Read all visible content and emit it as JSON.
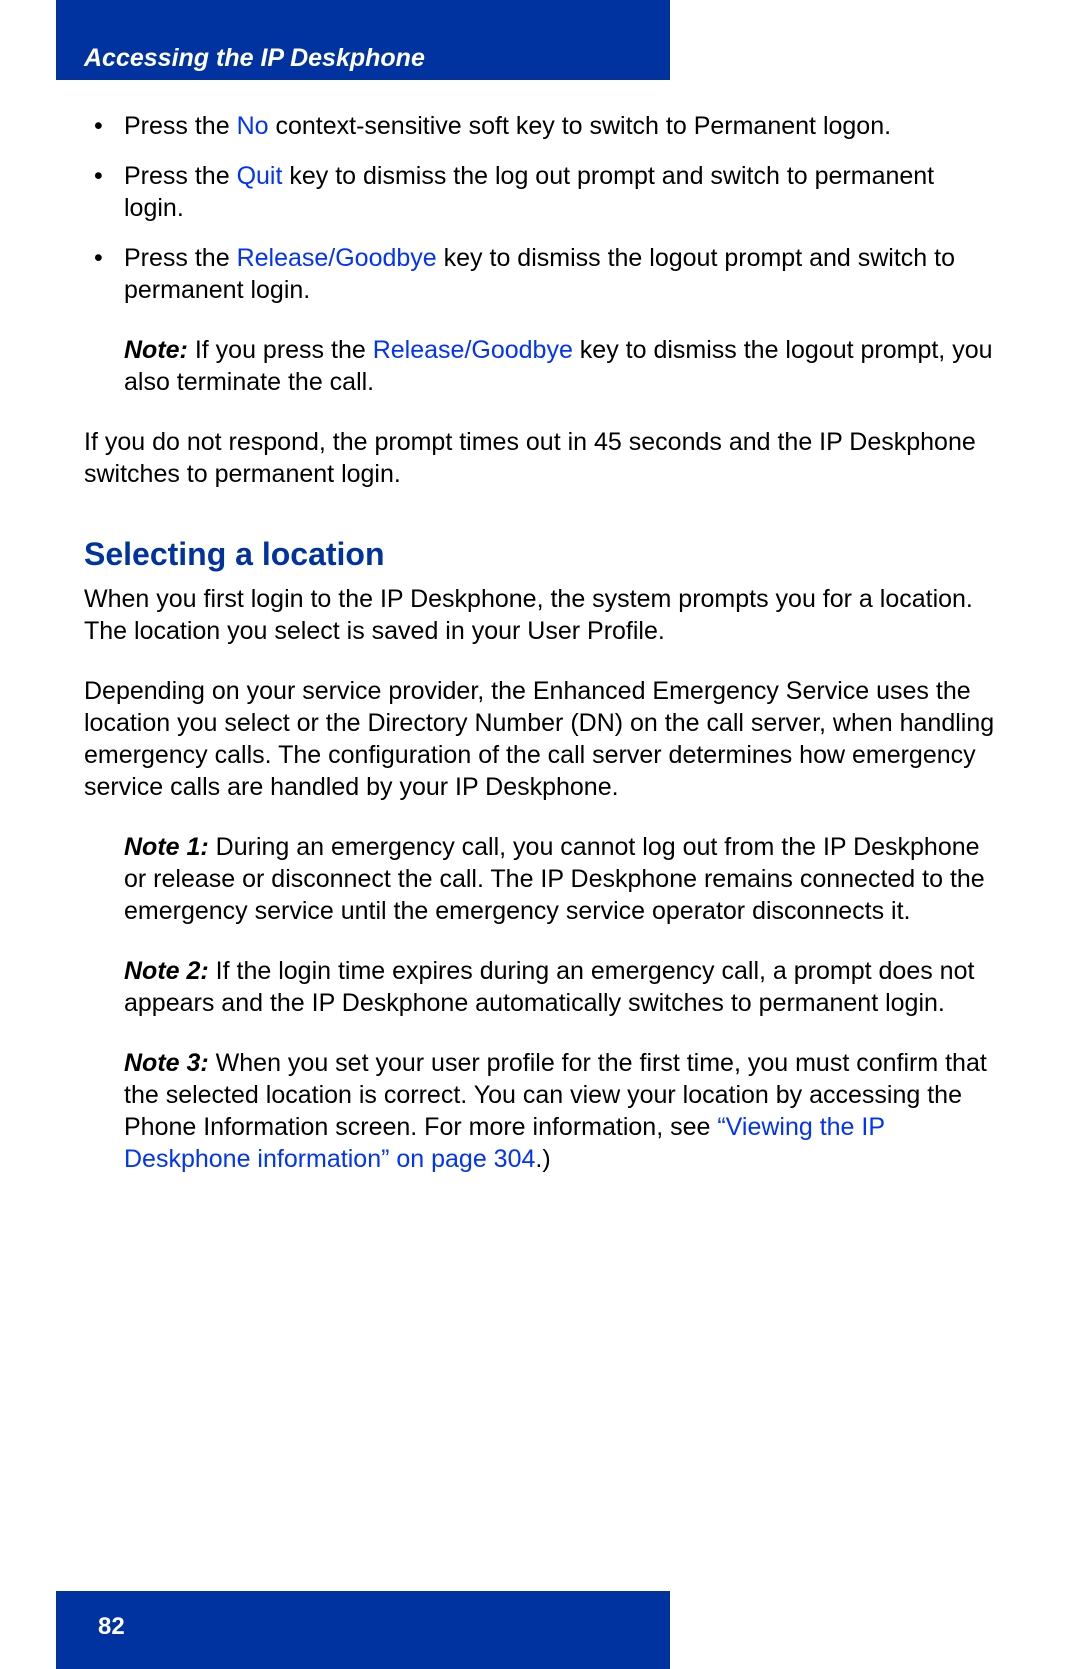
{
  "header": {
    "title": "Accessing the IP Deskphone"
  },
  "bullets": {
    "b1_pre": "Press the ",
    "b1_link": "No",
    "b1_post": " context-sensitive soft key to switch to Permanent logon.",
    "b2_pre": "Press the ",
    "b2_link": "Quit",
    "b2_post": "  key to dismiss the log out prompt and switch to permanent login.",
    "b3_pre": "Press the ",
    "b3_link": "Release/Goodbye",
    "b3_post": "   key to dismiss the logout prompt and switch to permanent login."
  },
  "note0": {
    "label": "Note:",
    "pre": "  If you press the ",
    "link": "Release/Goodbye",
    "post": "   key to dismiss the logout prompt, you also terminate the call."
  },
  "para_timeout": "If you do not respond, the prompt times out in 45 seconds and the IP Deskphone switches to permanent login.",
  "heading": "Selecting a location",
  "para_loc1": "When you first login to the IP Deskphone, the system prompts you for a location. The location you select is saved in your User Profile.",
  "para_loc2": "Depending on your service provider, the Enhanced Emergency Service uses the location you select or the Directory Number (DN) on the call server, when handling emergency calls. The configuration of the call server determines how emergency service calls are handled by your IP Deskphone.",
  "note1": {
    "label": "Note 1:",
    "text": "  During an emergency call, you cannot log out from the IP Deskphone or release or disconnect the call. The IP Deskphone remains connected to the emergency service until the emergency service operator disconnects it."
  },
  "note2": {
    "label": "Note 2:",
    "text": "  If the login time expires during an emergency call, a prompt does not appears and the IP Deskphone automatically switches to permanent login."
  },
  "note3": {
    "label": "Note 3:",
    "pre": "  When you set your user profile for the first time, you must confirm that the selected location is correct. You can view your location by accessing the Phone Information screen. For more information, see ",
    "link": "“Viewing the IP Deskphone information” on page 304",
    "post": ".)"
  },
  "page_number": "82"
}
